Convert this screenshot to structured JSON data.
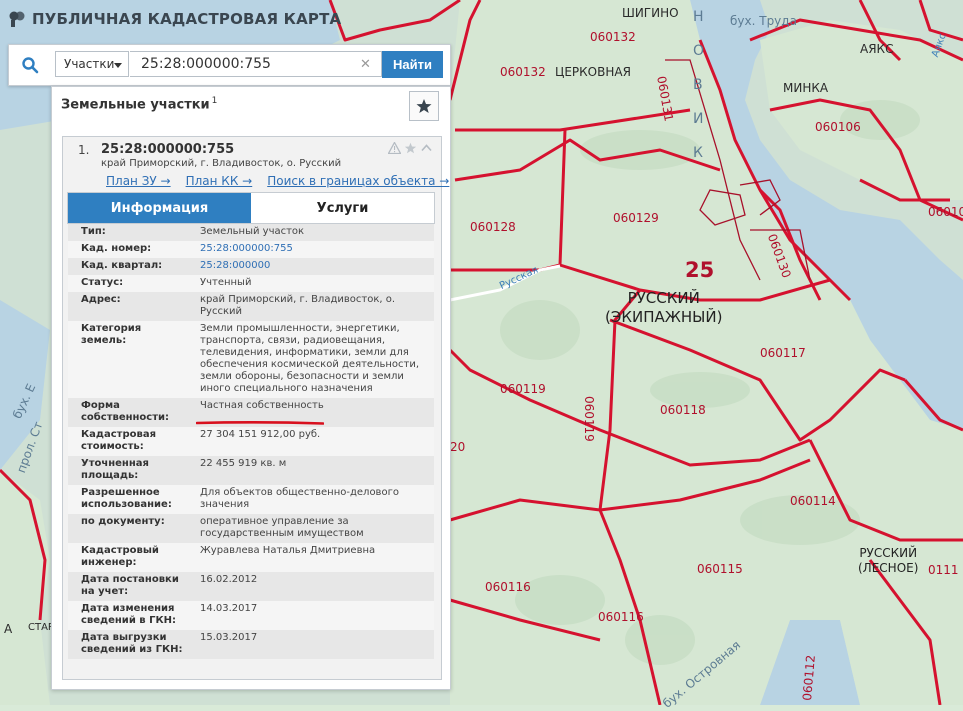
{
  "app": {
    "title": "ПУБЛИЧНАЯ КАДАСТРОВАЯ КАРТА"
  },
  "search": {
    "type_label": "Участки",
    "value": "25:28:000000:755",
    "button_label": "Найти"
  },
  "panel": {
    "title": "Земельные участки",
    "count": "1"
  },
  "card": {
    "number": "1.",
    "cadnum": "25:28:000000:755",
    "address": "край Приморский, г. Владивосток, о. Русский",
    "links": {
      "plan_zu": "План ЗУ →",
      "plan_kk": "План КК →",
      "search_bounds": "Поиск в границах объекта →"
    },
    "tabs": {
      "info": "Информация",
      "services": "Услуги"
    }
  },
  "attributes": [
    {
      "key": "Тип:",
      "value": "Земельный участок"
    },
    {
      "key": "Кад. номер:",
      "value": "25:28:000000:755"
    },
    {
      "key": "Кад. квартал:",
      "value": "25:28:000000"
    },
    {
      "key": "Статус:",
      "value": "Учтенный"
    },
    {
      "key": "Адрес:",
      "value": "край Приморский, г. Владивосток, о. Русский"
    },
    {
      "key": "Категория земель:",
      "value": "Земли промышленности, энергетики, транспорта, связи, радиовещания, телевидения, информатики, земли для обеспечения космической деятельности, земли обороны, безопасности и земли иного специального назначения"
    },
    {
      "key": "Форма собственности:",
      "value": "Частная собственность"
    },
    {
      "key": "Кадастровая стоимость:",
      "value": "27 304 151 912,00 руб."
    },
    {
      "key": "Уточненная площадь:",
      "value": "22 455 919 кв. м"
    },
    {
      "key": "Разрешенное использование:",
      "value": "Для объектов общественно-делового значения"
    },
    {
      "key": "по документу:",
      "value": "оперативное управление за государственным имуществом"
    },
    {
      "key": "Кадастровый инженер:",
      "value": "Журавлева Наталья Дмитриевна"
    },
    {
      "key": "Дата постановки на учет:",
      "value": "16.02.2012"
    },
    {
      "key": "Дата изменения сведений в ГКН:",
      "value": "14.03.2017"
    },
    {
      "key": "Дата выгрузки сведений из ГКН:",
      "value": "15.03.2017"
    }
  ],
  "map_labels": {
    "l060132a": "060132",
    "l060132b": "060132",
    "tserkovnaya": "ЦЕРКОВНАЯ",
    "shigino": "ШИГИНО",
    "bukh_trud": "бух. Труда",
    "l060131": "060131",
    "ayaks": "АЯКС",
    "minka": "МИНКА",
    "l060106": "060106",
    "l06010": "06010",
    "l060128": "060128",
    "l060129": "060129",
    "l060130": "060130",
    "quarter25": "25",
    "russkiy_ekip": "РУССКИЙ\n(ЭКИПАЖНЫЙ)",
    "russkaya_road": "Русская",
    "l060117": "060117",
    "l060119a": "060119",
    "l060119b": "060119",
    "l060118": "060118",
    "l060114": "060114",
    "l060115": "060115",
    "l060116a": "060116",
    "l060116b": "060116",
    "russkiy_lesnoe": "РУССКИЙ\n(ЛЕСНОЕ)",
    "l0111": "0111",
    "l060112": "060112",
    "bukh_ostrovnaya": "бух. Островная",
    "l20": "20",
    "strait_letters": "Н О В И К",
    "bukh_left": "бух. Е",
    "prol_left": "прол. Ст",
    "a_left": "А",
    "star_left": "СТАР",
    "a_right": "Аякс"
  }
}
